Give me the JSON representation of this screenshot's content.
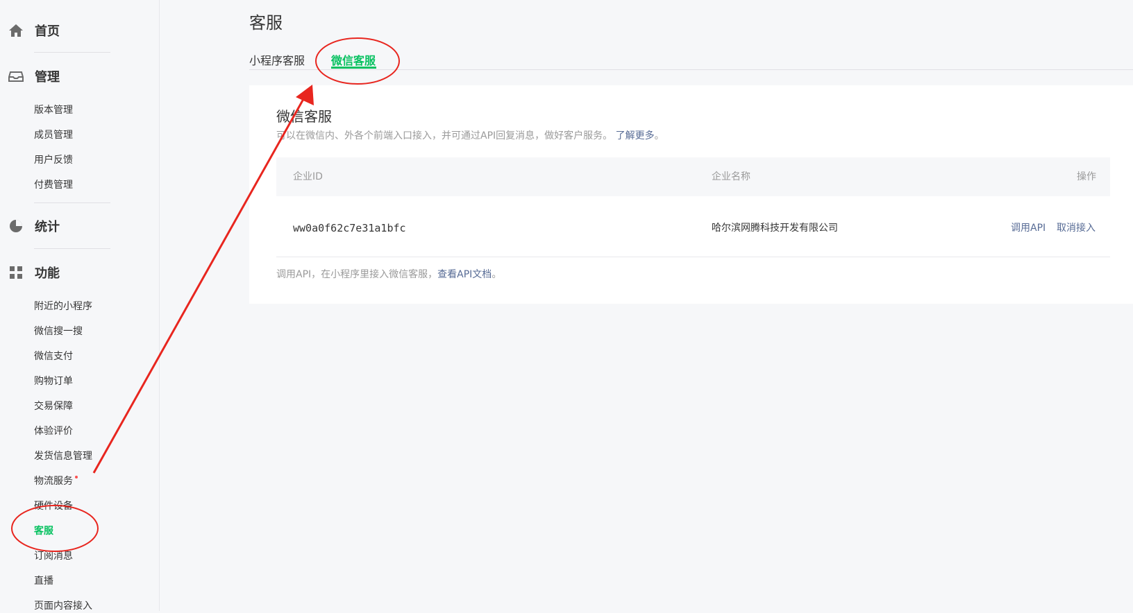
{
  "sidebar": {
    "sections": [
      {
        "label": "首页",
        "icon": "home-icon"
      },
      {
        "label": "管理",
        "icon": "inbox-icon",
        "items": [
          "版本管理",
          "成员管理",
          "用户反馈",
          "付费管理"
        ]
      },
      {
        "label": "统计",
        "icon": "pie-chart-icon"
      },
      {
        "label": "功能",
        "icon": "grid-icon",
        "items": [
          "附近的小程序",
          "微信搜一搜",
          "微信支付",
          "购物订单",
          "交易保障",
          "体验评价",
          "发货信息管理",
          "物流服务",
          "硬件设备",
          "客服",
          "订阅消息",
          "直播",
          "页面内容接入"
        ]
      }
    ],
    "active_item": "客服",
    "notify_item": "物流服务"
  },
  "page": {
    "title": "客服",
    "tabs": [
      "小程序客服",
      "微信客服"
    ],
    "active_tab": "微信客服"
  },
  "card": {
    "title": "微信客服",
    "desc": "可以在微信内、外各个前端入口接入，并可通过API回复消息，做好客户服务。",
    "desc_link": "了解更多",
    "desc_suffix": "。",
    "table": {
      "headers": [
        "企业ID",
        "企业名称",
        "操作"
      ],
      "rows": [
        {
          "id": "ww0a0f62c7e31a1bfc",
          "name": "哈尔滨网腾科技开发有限公司",
          "actions": [
            "调用API",
            "取消接入"
          ]
        }
      ]
    },
    "footer": "调用API，在小程序里接入微信客服，",
    "footer_link": "查看API文档",
    "footer_suffix": "。"
  },
  "colors": {
    "accent": "#07c160",
    "link": "#576b95",
    "annotation": "#e8261f"
  }
}
